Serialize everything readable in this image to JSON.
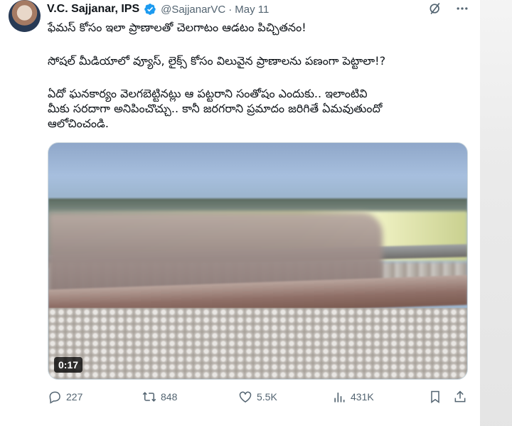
{
  "author": {
    "name": "V.C. Sajjanar, IPS",
    "handle": "@SajjanarVC",
    "separator": "·",
    "date": "May 11"
  },
  "tweet": {
    "paragraph1": "ఫేమస్ కోసం ఇలా ప్రాణాలతో చెలగాటం ఆడటం పిచ్చితనం!",
    "paragraph2": "సోషల్ మీడియాలో వ్యూస్, లైక్స్ కోసం విలువైన ప్రాణాలను పణంగా పెట్టాలా!?",
    "paragraph3_line1": "ఏదో ఘనకార్యం వెలగబెట్టినట్లు ఆ పట్టరాని సంతోషం ఎందుకు.. ఇలాంటివి",
    "paragraph3_line2": "మీకు సరదాగా అనిపించొచ్చు.. కానీ జరగరాని ప్రమాదం జరిగితే ఏమవుతుందో",
    "paragraph3_line3": "ఆలోచించండి."
  },
  "media": {
    "duration": "0:17"
  },
  "metrics": {
    "replies": "227",
    "reposts": "848",
    "likes": "5.5K",
    "views": "431K"
  },
  "icons": [
    "verified-badge-icon",
    "grok-icon",
    "more-icon",
    "reply-icon",
    "repost-icon",
    "like-icon",
    "views-icon",
    "bookmark-icon",
    "share-icon"
  ],
  "colors": {
    "verified": "#1d9bf0",
    "muted": "#536471",
    "text": "#0f1419"
  }
}
